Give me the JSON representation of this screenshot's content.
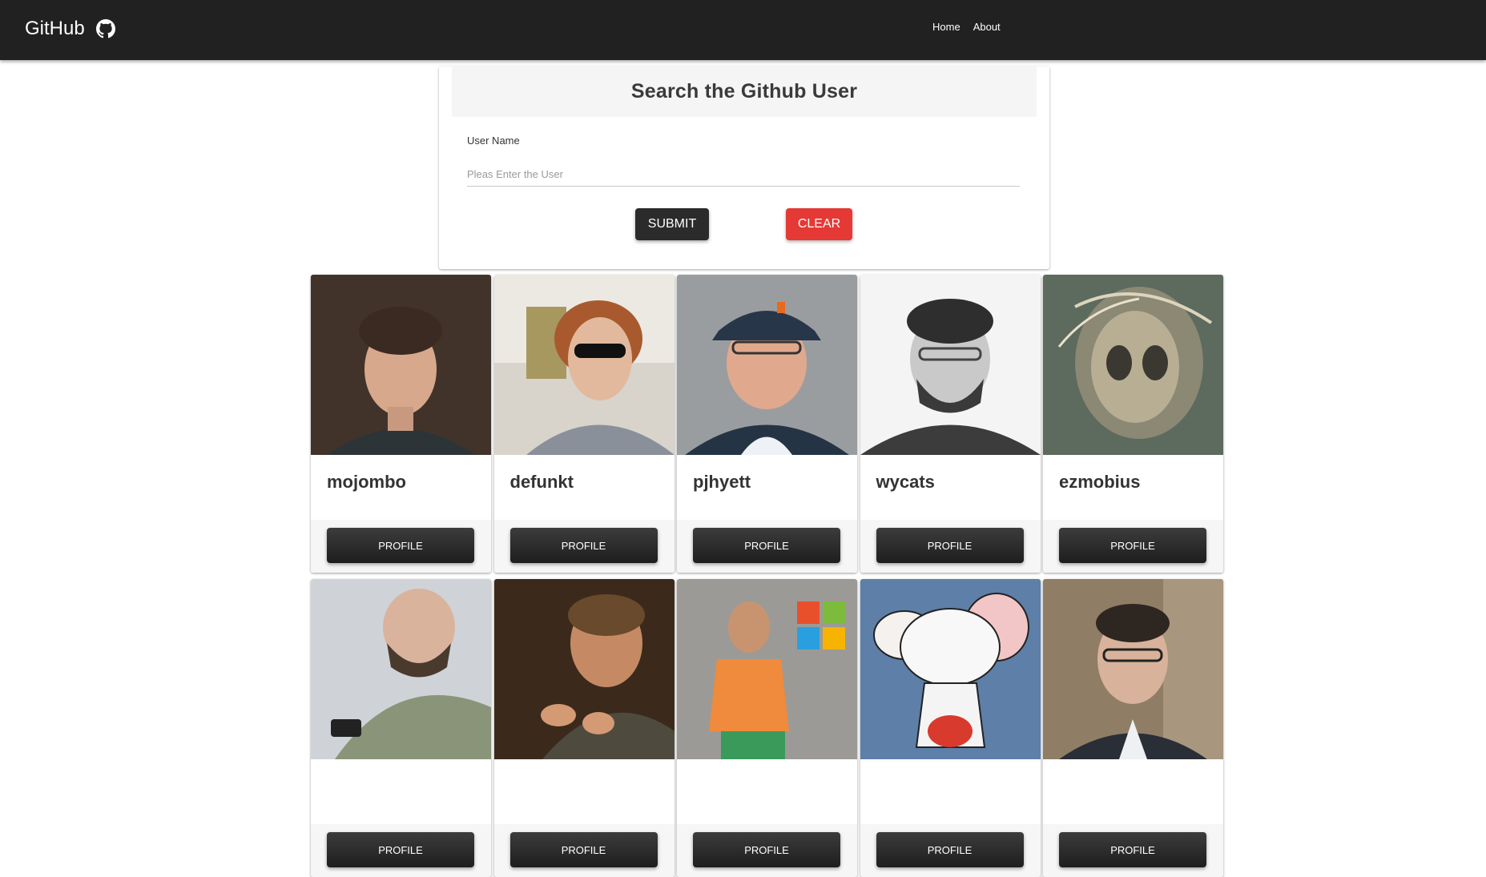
{
  "appbar": {
    "brand": "GitHub",
    "brand_icon": "github-icon",
    "nav": [
      {
        "label": "Home"
      },
      {
        "label": "About"
      }
    ],
    "bg_color": "#212121"
  },
  "search": {
    "title": "Search the Github User",
    "field_label": "User Name",
    "placeholder": "Pleas Enter the User",
    "value": "",
    "submit_label": "SUBMIT",
    "clear_label": "CLEAR",
    "clear_color": "#e53935"
  },
  "users": [
    {
      "login": "mojombo",
      "button": "PROFILE"
    },
    {
      "login": "defunkt",
      "button": "PROFILE"
    },
    {
      "login": "pjhyett",
      "button": "PROFILE"
    },
    {
      "login": "wycats",
      "button": "PROFILE"
    },
    {
      "login": "ezmobius",
      "button": "PROFILE"
    },
    {
      "login": "",
      "button": "PROFILE"
    },
    {
      "login": "",
      "button": "PROFILE"
    },
    {
      "login": "",
      "button": "PROFILE"
    },
    {
      "login": "",
      "button": "PROFILE"
    },
    {
      "login": "",
      "button": "PROFILE"
    }
  ]
}
